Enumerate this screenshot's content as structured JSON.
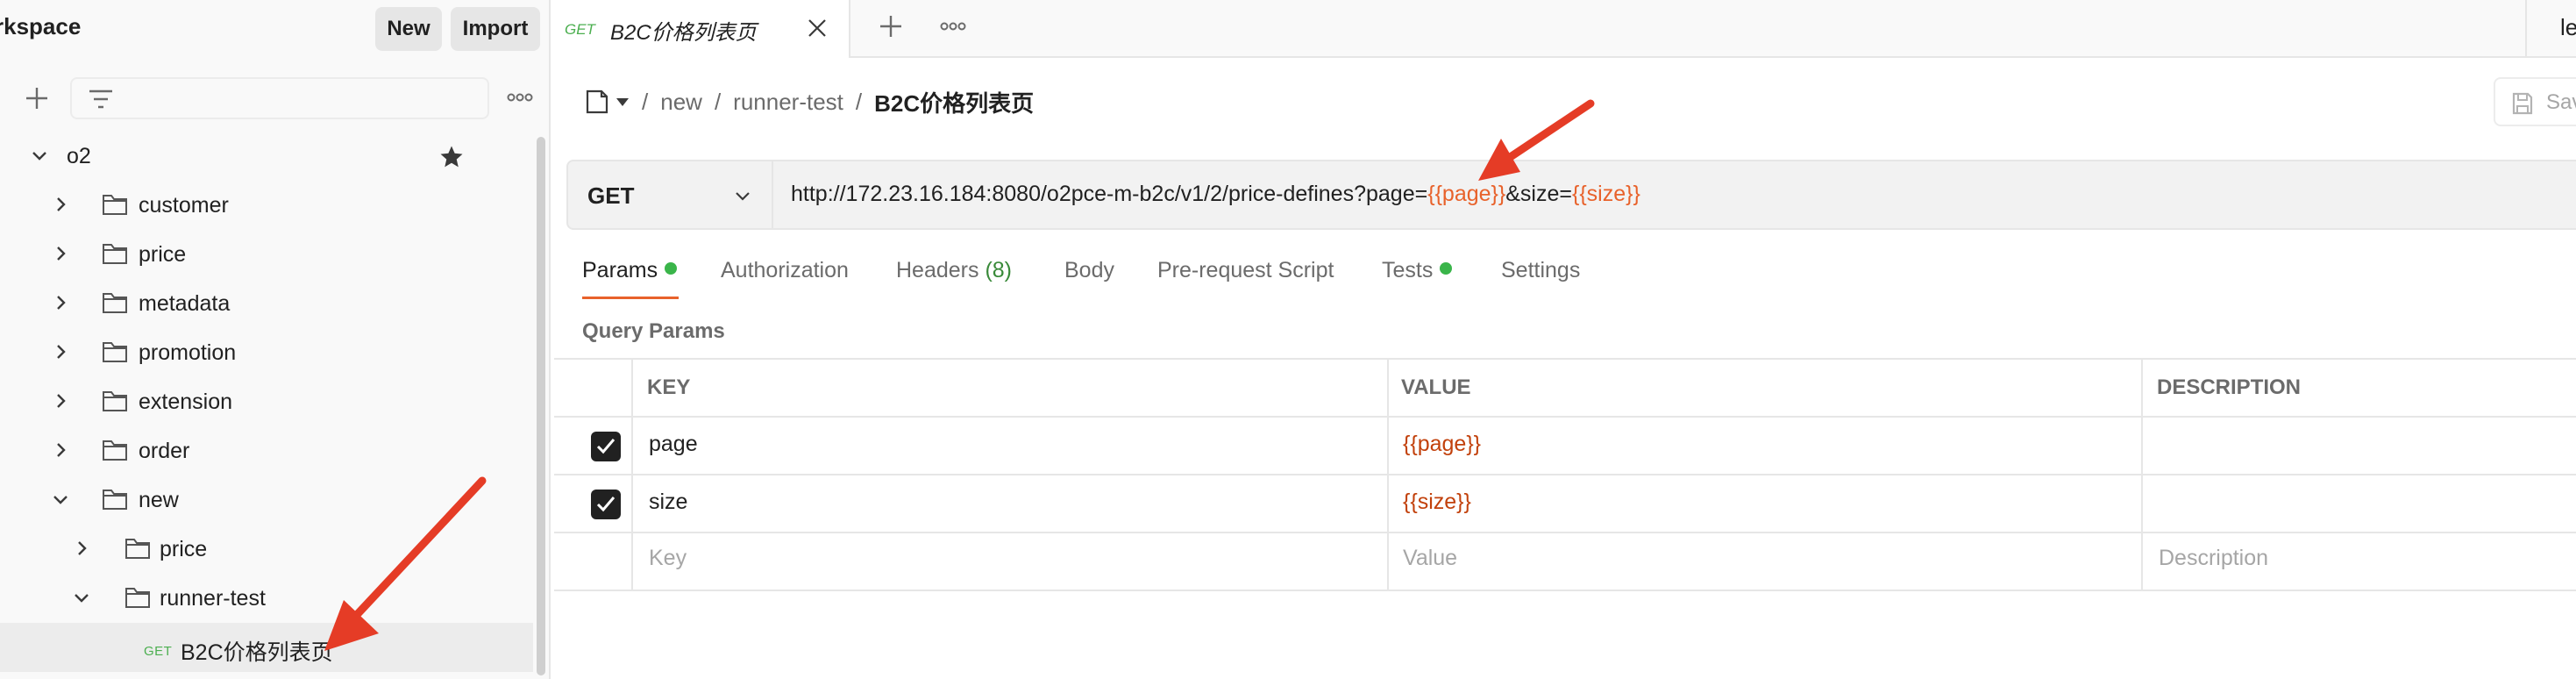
{
  "workspace": {
    "title": "rkspace",
    "new_label": "New",
    "import_label": "Import"
  },
  "tree": {
    "root": "o2",
    "folders": [
      "customer",
      "price",
      "metadata",
      "promotion",
      "extension",
      "order",
      "new"
    ],
    "new_children": {
      "price": "price",
      "runner_test": "runner-test"
    },
    "request": {
      "method": "GET",
      "name": "B2C价格列表页"
    }
  },
  "tabs": {
    "active": {
      "method": "GET",
      "title": "B2C价格列表页"
    },
    "partial_text": "le"
  },
  "breadcrumb": {
    "items": [
      "new",
      "runner-test"
    ],
    "current": "B2C价格列表页"
  },
  "save": {
    "label": "Sav"
  },
  "request": {
    "method": "GET",
    "url_base": "http://172.23.16.184:8080/o2pce-m-b2c/v1/2/price-defines?page=",
    "url_var_page": "{{page}}",
    "url_mid": "&size=",
    "url_var_size": "{{size}}"
  },
  "request_tabs": {
    "params": "Params",
    "authorization": "Authorization",
    "headers": "Headers",
    "headers_count": "(8)",
    "body": "Body",
    "prerequest": "Pre-request Script",
    "tests": "Tests",
    "settings": "Settings"
  },
  "query_params": {
    "title": "Query Params",
    "headers": {
      "key": "KEY",
      "value": "VALUE",
      "description": "DESCRIPTION"
    },
    "rows": [
      {
        "key": "page",
        "value": "{{page}}",
        "checked": true
      },
      {
        "key": "size",
        "value": "{{size}}",
        "checked": true
      }
    ],
    "placeholders": {
      "key": "Key",
      "value": "Value",
      "description": "Description"
    }
  },
  "colors": {
    "accent": "#e8622b",
    "get_method": "#4caf50",
    "annotation_arrow": "#e53c26"
  }
}
